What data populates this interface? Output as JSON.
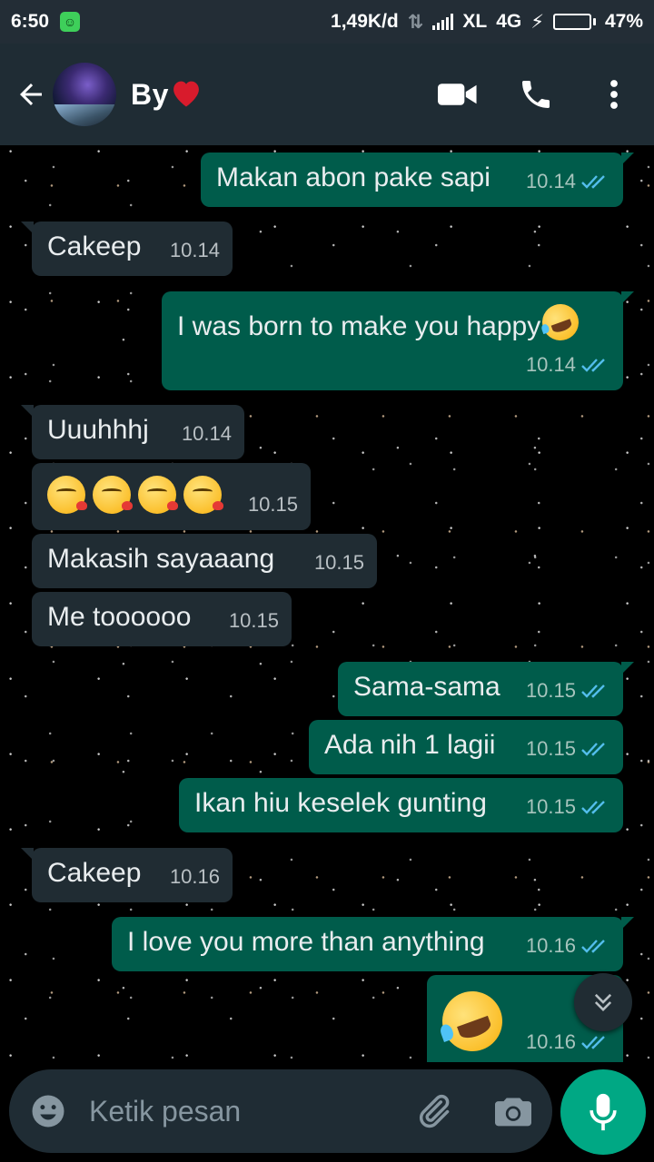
{
  "status_bar": {
    "time": "6:50",
    "net_speed": "1,49K/d",
    "carrier": "XL",
    "network": "4G",
    "battery": "47%",
    "battery_level": 0.47
  },
  "header": {
    "contact_name": "By",
    "contact_name_emoji": "❤️"
  },
  "messages": [
    {
      "dir": "out",
      "text": "Makan abon pake sapi",
      "time": "10.14",
      "read": true
    },
    {
      "dir": "in",
      "text": "Cakeep",
      "time": "10.14"
    },
    {
      "dir": "out",
      "text": "I was born to make you happy",
      "time": "10.14",
      "read": true,
      "trailing_emoji": "rolling-laughing-emoji"
    },
    {
      "dir": "in",
      "text": "Uuuhhhj",
      "time": "10.14"
    },
    {
      "dir": "in",
      "text": "",
      "time": "10.15",
      "emojis": [
        "kissing-heart-emoji",
        "kissing-heart-emoji",
        "kissing-heart-emoji",
        "kissing-heart-emoji"
      ]
    },
    {
      "dir": "in",
      "text": "Makasih sayaaang",
      "time": "10.15"
    },
    {
      "dir": "in",
      "text": "Me toooooo",
      "time": "10.15"
    },
    {
      "dir": "out",
      "text": "Sama-sama",
      "time": "10.15",
      "read": true
    },
    {
      "dir": "out",
      "text": "Ada nih 1 lagii",
      "time": "10.15",
      "read": true
    },
    {
      "dir": "out",
      "text": "Ikan hiu keselek gunting",
      "time": "10.15",
      "read": true
    },
    {
      "dir": "in",
      "text": "Cakeep",
      "time": "10.16"
    },
    {
      "dir": "out",
      "text": "I love you more than anything",
      "time": "10.16",
      "read": true
    },
    {
      "dir": "out",
      "text": "",
      "time": "10.16",
      "read": true,
      "emojis": [
        "rolling-laughing-emoji"
      ]
    }
  ],
  "composer": {
    "placeholder": "Ketik pesan"
  },
  "colors": {
    "outgoing_bubble": "#005c4b",
    "incoming_bubble": "#202c33",
    "read_ticks": "#53bdeb",
    "mic_button": "#00a884",
    "header_bg": "#1f2c34"
  }
}
